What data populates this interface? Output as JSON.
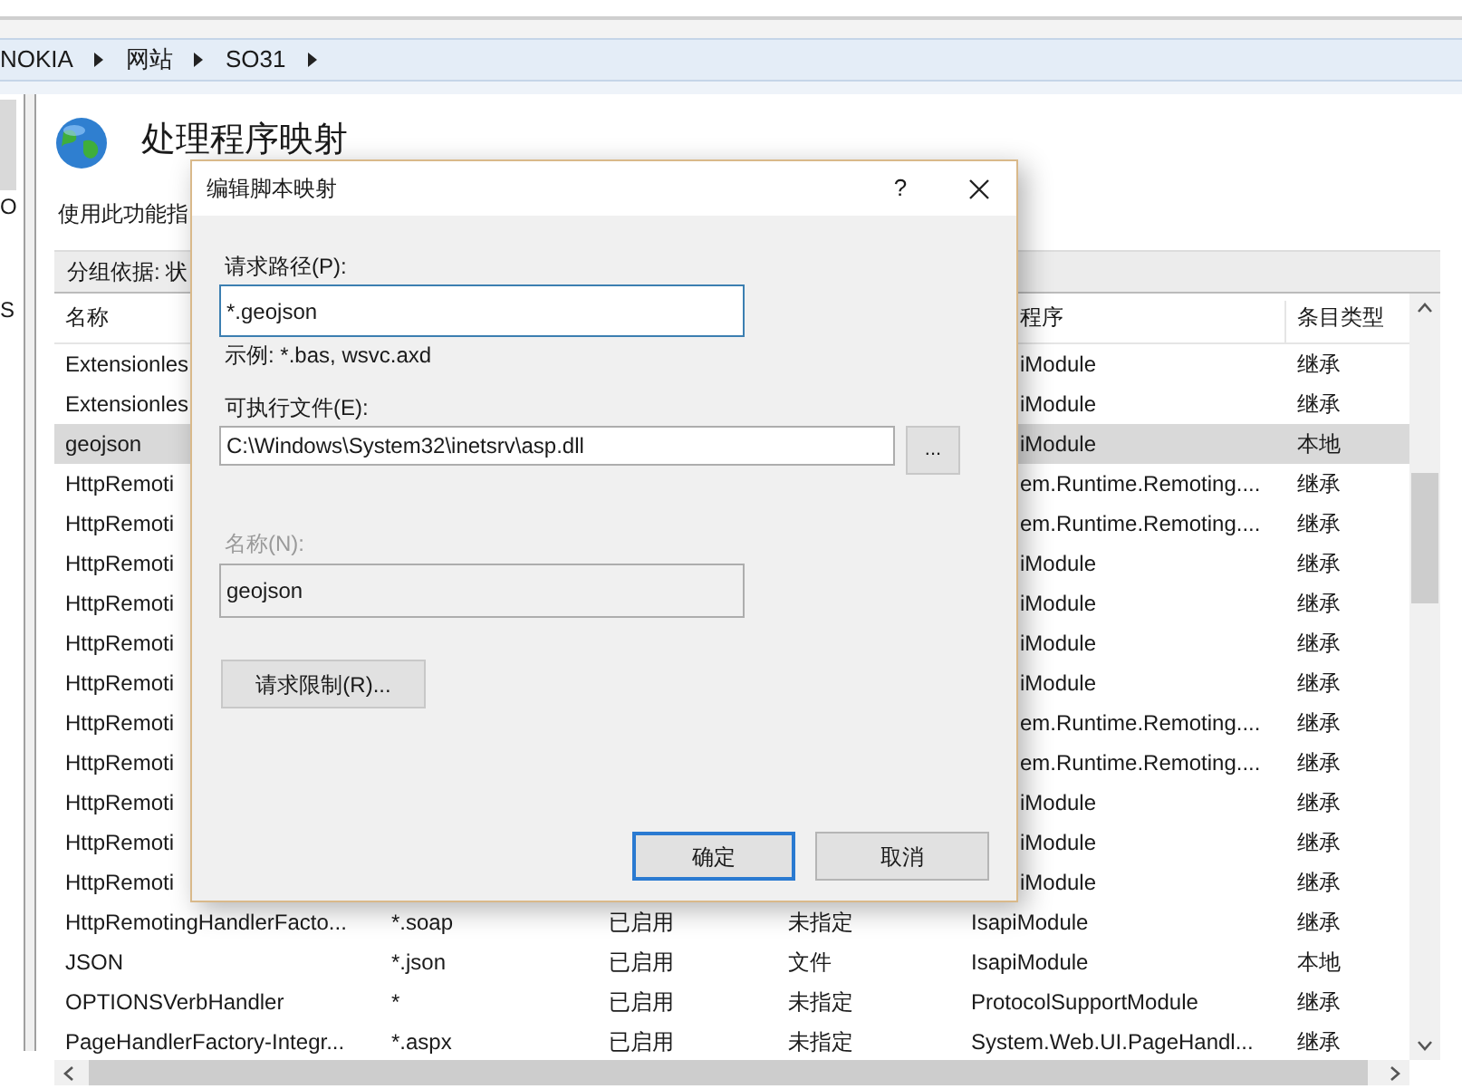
{
  "breadcrumb": [
    "NOKIA",
    "网站",
    "SO31"
  ],
  "left_pane_text": [
    "O",
    "S"
  ],
  "page": {
    "title": "处理程序映射",
    "description": "使用此功能指",
    "group_by": "分组依据: 状"
  },
  "table": {
    "columns": [
      "名称",
      "程序",
      "条目类型"
    ],
    "rows": [
      {
        "name": "Extensionles",
        "handler": "iModule",
        "entry_type": "继承",
        "selected": false
      },
      {
        "name": "Extensionles",
        "handler": "iModule",
        "entry_type": "继承",
        "selected": false
      },
      {
        "name": "geojson",
        "handler": "iModule",
        "entry_type": "本地",
        "selected": true
      },
      {
        "name": "HttpRemoti",
        "handler": "em.Runtime.Remoting....",
        "entry_type": "继承",
        "selected": false
      },
      {
        "name": "HttpRemoti",
        "handler": "em.Runtime.Remoting....",
        "entry_type": "继承",
        "selected": false
      },
      {
        "name": "HttpRemoti",
        "handler": "iModule",
        "entry_type": "继承",
        "selected": false
      },
      {
        "name": "HttpRemoti",
        "handler": "iModule",
        "entry_type": "继承",
        "selected": false
      },
      {
        "name": "HttpRemoti",
        "handler": "iModule",
        "entry_type": "继承",
        "selected": false
      },
      {
        "name": "HttpRemoti",
        "handler": "iModule",
        "entry_type": "继承",
        "selected": false
      },
      {
        "name": "HttpRemoti",
        "handler": "em.Runtime.Remoting....",
        "entry_type": "继承",
        "selected": false
      },
      {
        "name": "HttpRemoti",
        "handler": "em.Runtime.Remoting....",
        "entry_type": "继承",
        "selected": false
      },
      {
        "name": "HttpRemoti",
        "handler": "iModule",
        "entry_type": "继承",
        "selected": false
      },
      {
        "name": "HttpRemoti",
        "handler": "iModule",
        "entry_type": "继承",
        "selected": false
      },
      {
        "name": "HttpRemoti",
        "handler": "iModule",
        "entry_type": "继承",
        "selected": false
      },
      {
        "name": "HttpRemotingHandlerFacto...",
        "path": "*.soap",
        "state": "已启用",
        "path_type": "未指定",
        "handler": "IsapiModule",
        "entry_type": "继承",
        "selected": false
      },
      {
        "name": "JSON",
        "path": "*.json",
        "state": "已启用",
        "path_type": "文件",
        "handler": "IsapiModule",
        "entry_type": "本地",
        "selected": false
      },
      {
        "name": "OPTIONSVerbHandler",
        "path": "*",
        "state": "已启用",
        "path_type": "未指定",
        "handler": "ProtocolSupportModule",
        "entry_type": "继承",
        "selected": false
      },
      {
        "name": "PageHandlerFactory-Integr...",
        "path": "*.aspx",
        "state": "已启用",
        "path_type": "未指定",
        "handler": "System.Web.UI.PageHandl...",
        "entry_type": "继承",
        "selected": false
      }
    ]
  },
  "dialog": {
    "title": "编辑脚本映射",
    "help": "?",
    "request_path": {
      "label": "请求路径(P):",
      "value": "*.geojson",
      "focused": true
    },
    "example": "示例: *.bas, wsvc.axd",
    "executable": {
      "label": "可执行文件(E):",
      "value": "C:\\Windows\\System32\\inetsrv\\asp.dll",
      "focused": false
    },
    "browse": "...",
    "name": {
      "label": "名称(N):",
      "value": "geojson",
      "disabled": true
    },
    "restrictions_button": "请求限制(R)...",
    "buttons": [
      {
        "label": "确定",
        "default": true
      },
      {
        "label": "取消",
        "default": false
      }
    ]
  }
}
